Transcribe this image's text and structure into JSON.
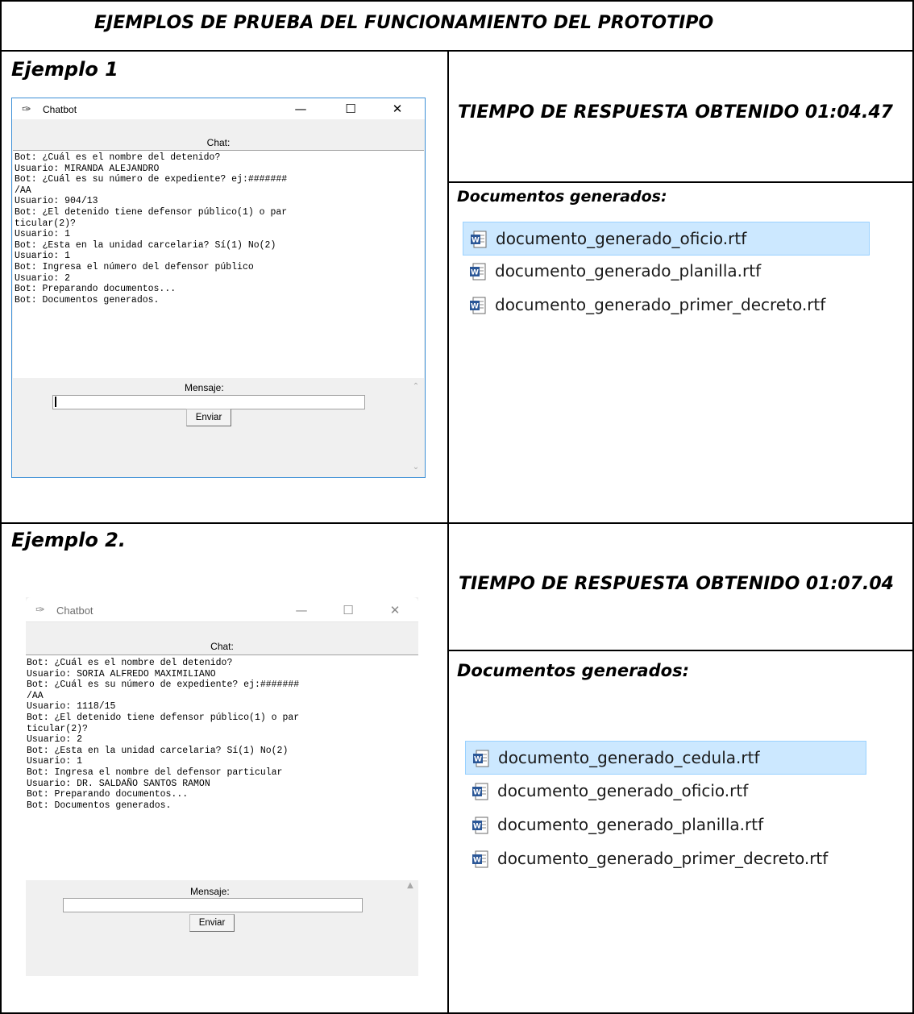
{
  "title": "EJEMPLOS DE PRUEBA DEL FUNCIONAMIENTO DEL PROTOTIPO",
  "examples": [
    {
      "label": "Ejemplo 1",
      "response_time": "TIEMPO DE RESPUESTA OBTENIDO 01:04.47",
      "docs_heading": "Documentos generados:",
      "window": {
        "title": "Chatbot",
        "chat_label": "Chat:",
        "chat_text": "Bot: ¿Cuál es el nombre del detenido?\nUsuario: MIRANDA ALEJANDRO\nBot: ¿Cuál es su número de expediente? ej:#######\n/AA\nUsuario: 904/13\nBot: ¿El detenido tiene defensor público(1) o par\nticular(2)?\nUsuario: 1\nBot: ¿Esta en la unidad carcelaria? Sí(1) No(2)\nUsuario: 1\nBot: Ingresa el número del defensor público\nUsuario: 2\nBot: Preparando documentos...\nBot: Documentos generados.",
        "message_label": "Mensaje:",
        "message_value": "",
        "send_label": "Enviar"
      },
      "files": [
        {
          "name": "documento_generado_oficio.rtf",
          "selected": true
        },
        {
          "name": "documento_generado_planilla.rtf",
          "selected": false
        },
        {
          "name": "documento_generado_primer_decreto.rtf",
          "selected": false
        }
      ]
    },
    {
      "label": "Ejemplo 2.",
      "response_time": "TIEMPO  DE RESPUESTA OBTENIDO 01:07.04",
      "docs_heading": "Documentos generados:",
      "window": {
        "title": "Chatbot",
        "chat_label": "Chat:",
        "chat_text": "Bot: ¿Cuál es el nombre del detenido?\nUsuario: SORIA ALFREDO MAXIMILIANO\nBot: ¿Cuál es su número de expediente? ej:#######\n/AA\nUsuario: 1118/15\nBot: ¿El detenido tiene defensor público(1) o par\nticular(2)?\nUsuario: 2\nBot: ¿Esta en la unidad carcelaria? Sí(1) No(2)\nUsuario: 1\nBot: Ingresa el nombre del defensor particular\nUsuario: DR. SALDAÑO SANTOS RAMON\nBot: Preparando documentos...\nBot: Documentos generados.",
        "message_label": "Mensaje:",
        "message_value": "",
        "send_label": "Enviar"
      },
      "files": [
        {
          "name": "documento_generado_cedula.rtf",
          "selected": true
        },
        {
          "name": "documento_generado_oficio.rtf",
          "selected": false
        },
        {
          "name": "documento_generado_planilla.rtf",
          "selected": false
        },
        {
          "name": "documento_generado_primer_decreto.rtf",
          "selected": false
        }
      ]
    }
  ],
  "window_controls": {
    "minimize": "—",
    "maximize": "☐",
    "close": "✕"
  },
  "icons": {
    "window": "feather-icon",
    "file": "word-document-icon"
  }
}
